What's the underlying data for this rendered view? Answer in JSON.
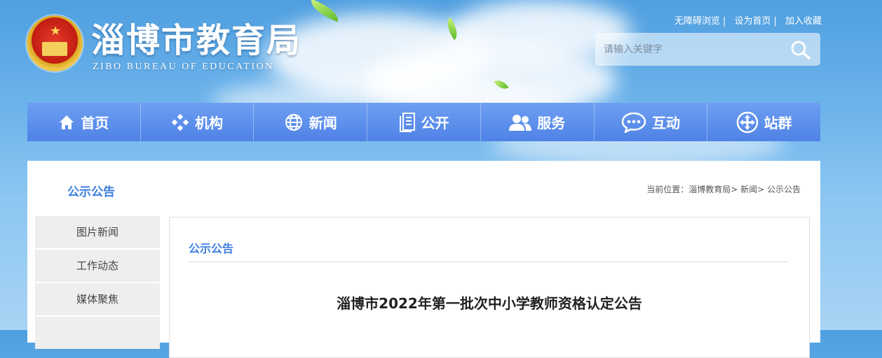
{
  "header": {
    "title": "淄博市教育局",
    "subtitle": "ZIBO BUREAU OF EDUCATION",
    "top_links": [
      "无障碍浏览",
      "设为首页",
      "加入收藏"
    ],
    "search_placeholder": "请输入关键字"
  },
  "nav": [
    {
      "label": "首页",
      "icon": "home-icon"
    },
    {
      "label": "机构",
      "icon": "org-icon"
    },
    {
      "label": "新闻",
      "icon": "globe-icon"
    },
    {
      "label": "公开",
      "icon": "document-icon"
    },
    {
      "label": "服务",
      "icon": "users-icon"
    },
    {
      "label": "互动",
      "icon": "chat-icon"
    },
    {
      "label": "站群",
      "icon": "site-group-icon"
    }
  ],
  "section": {
    "title": "公示公告",
    "breadcrumb_prefix": "当前位置：",
    "breadcrumb": [
      "淄博教育局",
      "新闻",
      "公示公告"
    ]
  },
  "sidebar": [
    "图片新闻",
    "工作动态",
    "媒体聚焦"
  ],
  "main": {
    "title": "公示公告",
    "article_title": "淄博市2022年第一批次中小学教师资格认定公告"
  },
  "colors": {
    "accent": "#3e7ee0",
    "nav": "#5b8ceb",
    "sky": "#6fb5ec"
  }
}
